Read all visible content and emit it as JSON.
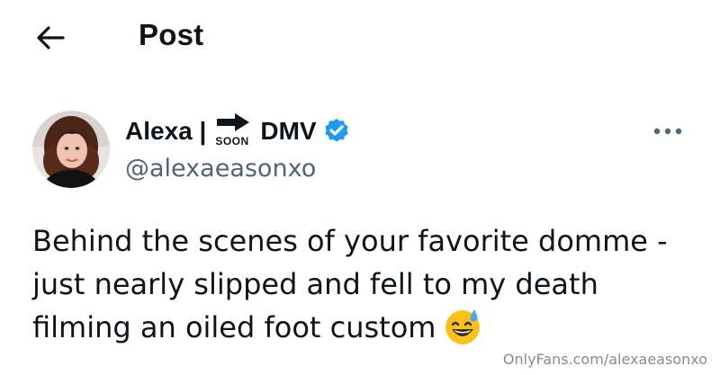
{
  "header": {
    "back_icon": "arrow-left-icon",
    "title": "Post"
  },
  "post": {
    "author": {
      "name_part1": "Alexa |",
      "badge_label": "SOON",
      "badge_icon": "right-arrow-icon",
      "name_part2": "DMV",
      "verified_icon": "verified-badge-icon",
      "verified_color": "#1d9bf0",
      "handle": "@alexaeasonxo"
    },
    "more_icon": "more-horizontal-icon",
    "text_lines": [
      "Behind the scenes of your favorite domme -",
      "just nearly slipped and fell to my death",
      "filming an oiled foot custom"
    ],
    "emoji": "sweat-smile-emoji"
  },
  "watermark": "OnlyFans.com/alexaeasonxo",
  "colors": {
    "text": "#0f1419",
    "secondary_text": "#536471",
    "accent": "#1d9bf0"
  }
}
